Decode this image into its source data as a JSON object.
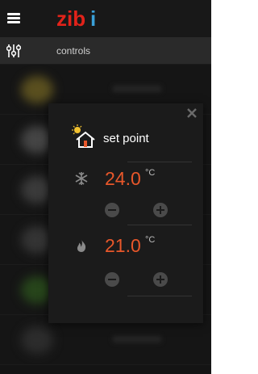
{
  "app": {
    "logo_text": "zibi"
  },
  "header": {
    "menu_icon": "hamburger-menu-icon"
  },
  "subbar": {
    "icon": "sliders-icon",
    "label": "controls"
  },
  "dialog": {
    "close_icon": "close-icon",
    "title": "set point",
    "title_icon": "house-sun-icon",
    "cooling": {
      "icon": "snowflake-icon",
      "value": "24.0",
      "unit": "°C"
    },
    "heating": {
      "icon": "flame-icon",
      "value": "21.0",
      "unit": "°C"
    }
  },
  "colors": {
    "accent": "#e8572a",
    "logo_red": "#e2231a",
    "logo_blue": "#3aa0d8",
    "background": "#1f1f1f",
    "dialog": "#1b1b1b"
  }
}
